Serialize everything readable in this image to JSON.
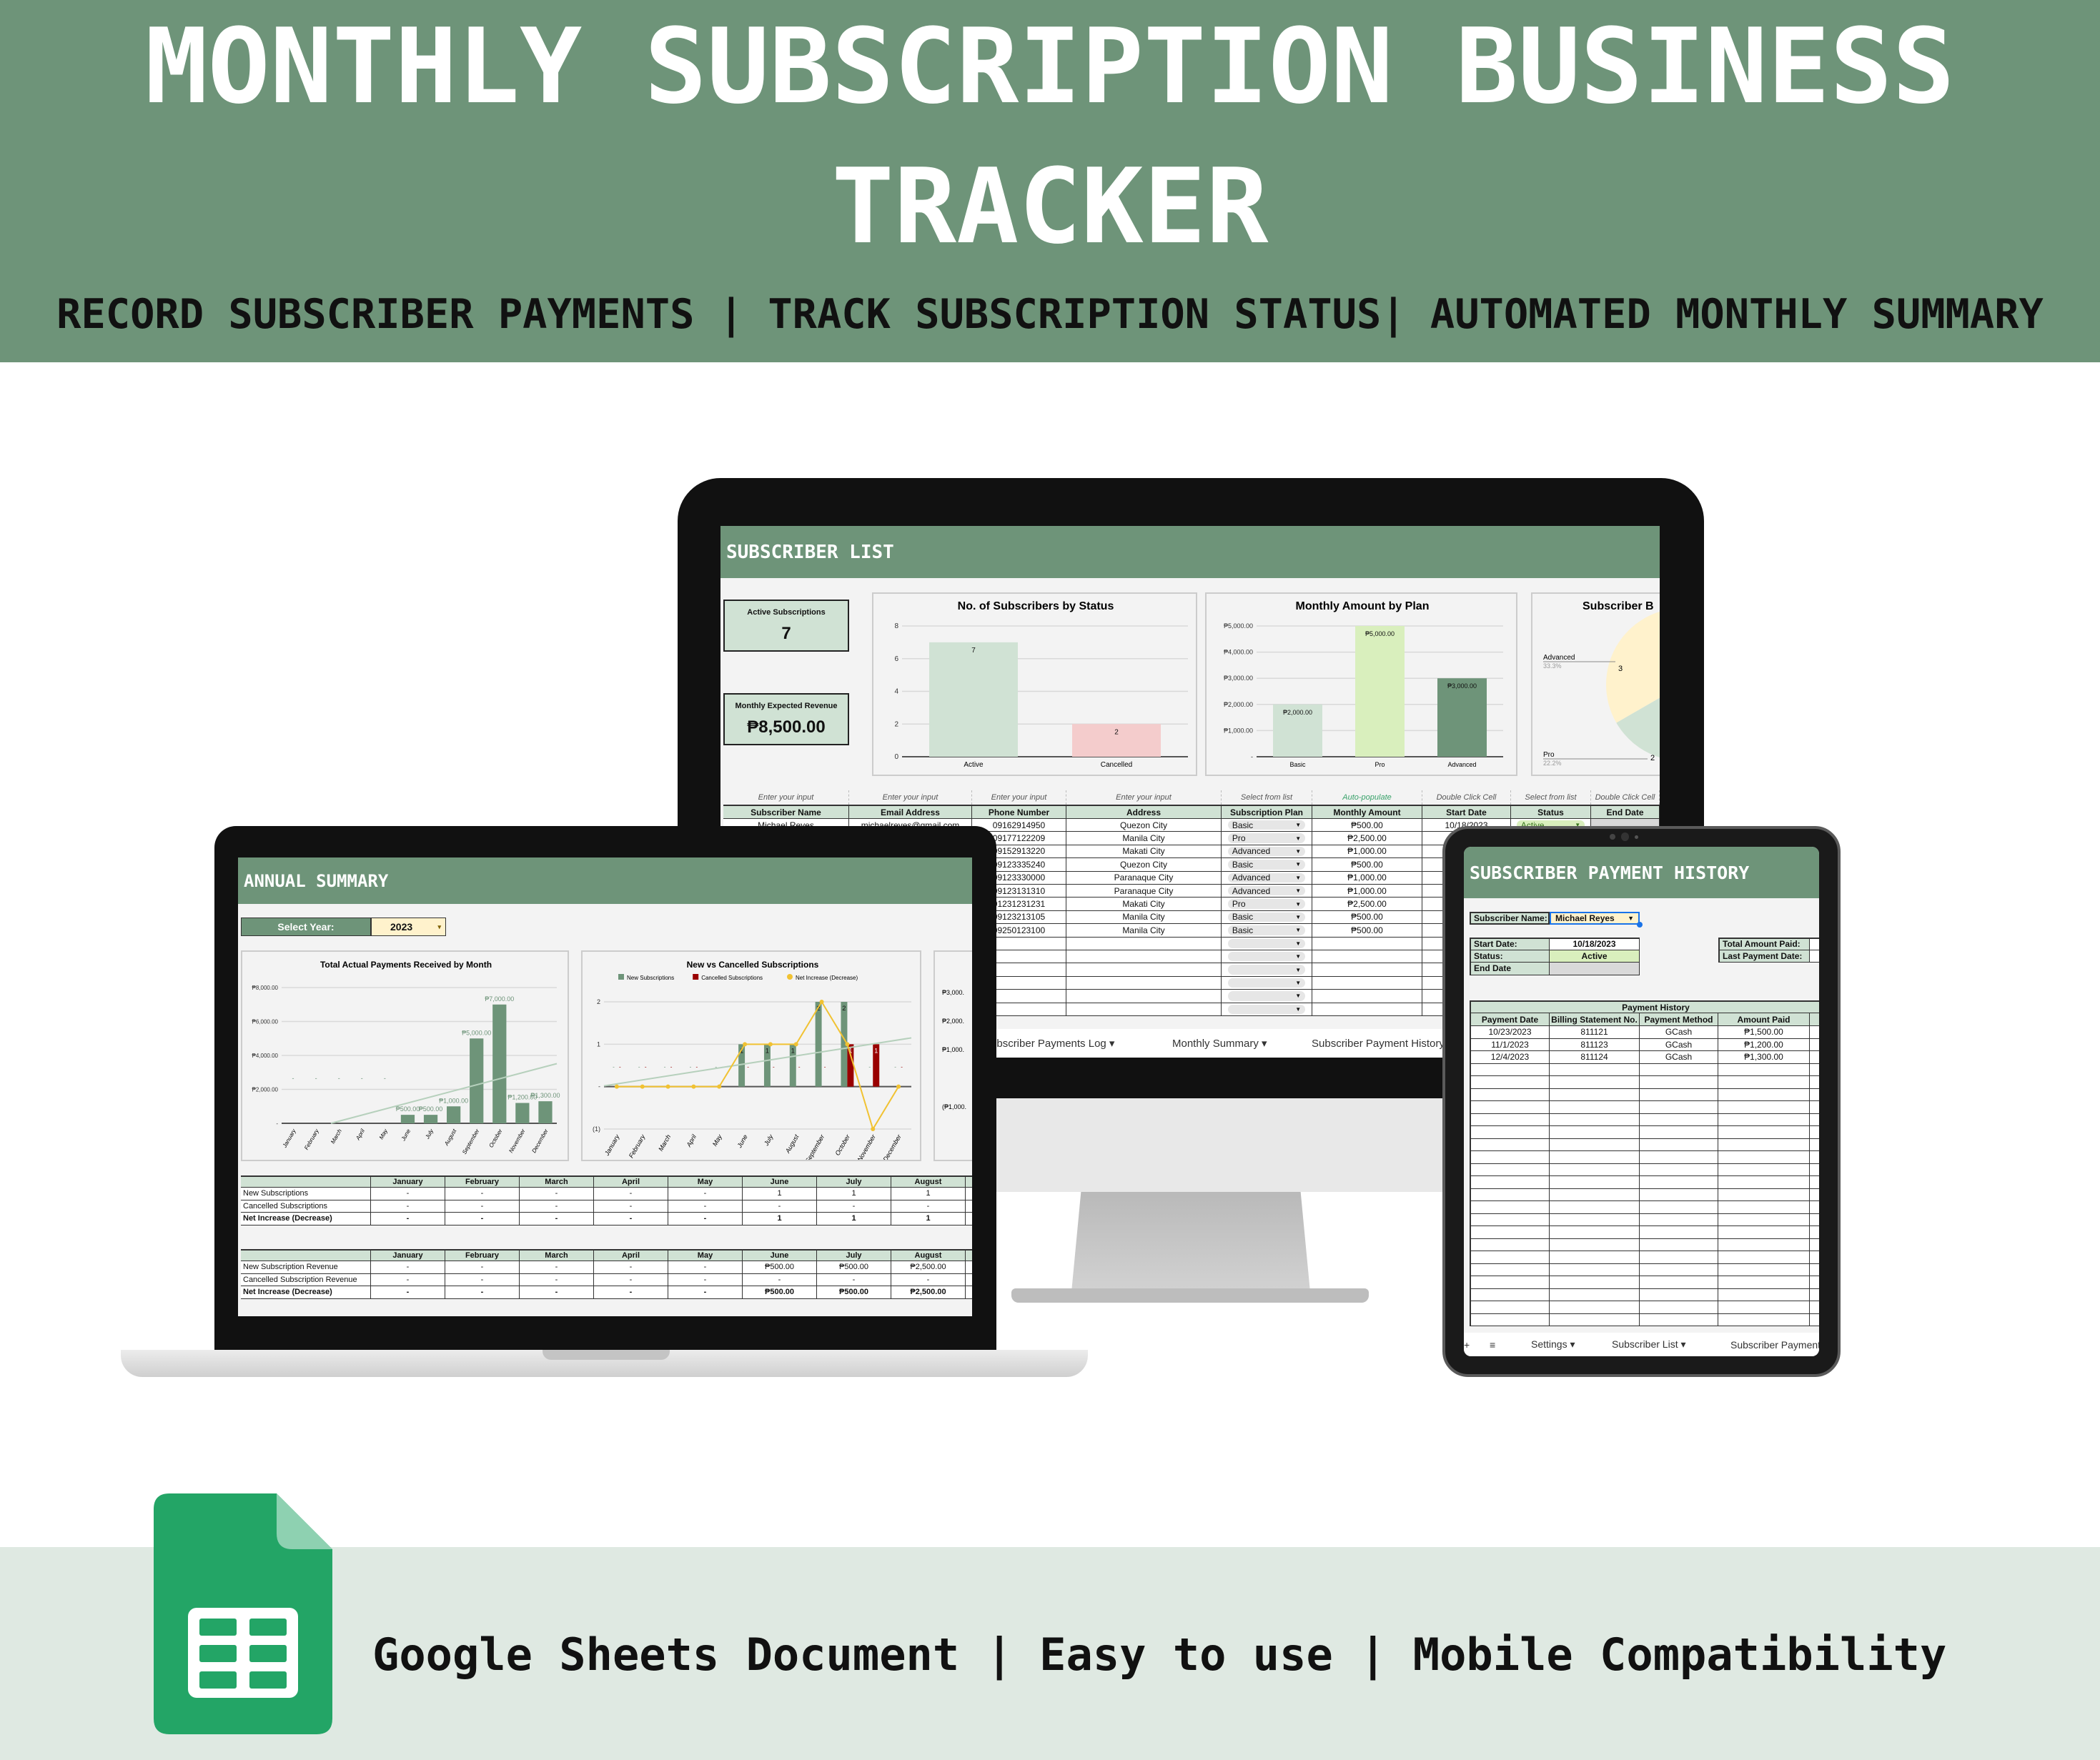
{
  "header": {
    "title": "MONTHLY SUBSCRIPTION BUSINESS TRACKER",
    "subtitle": "RECORD SUBSCRIBER PAYMENTS | TRACK SUBSCRIPTION STATUS| AUTOMATED MONTHLY SUMMARY"
  },
  "footer": {
    "text": "Google Sheets Document | Easy to use | Mobile Compatibility",
    "icon": "google-sheets-icon"
  },
  "colors": {
    "brand_green": "#6e9479",
    "light_green": "#d0e2d4",
    "footer_bg": "#dfe9e2",
    "yellow": "#fff2cc",
    "cancel_red": "#990000",
    "net_yellow": "#f1c232"
  },
  "monitor": {
    "sheet_title": "SUBSCRIBER LIST",
    "kpis": [
      {
        "label": "Active Subscriptions",
        "value": "7"
      },
      {
        "label": "Monthly Expected Revenue",
        "value": "₱8,500.00"
      }
    ],
    "table": {
      "hints": [
        "Enter your input",
        "Enter your input",
        "Enter your input",
        "Enter your input",
        "Select from list",
        "Auto-populate",
        "Double Click Cell",
        "Select from list",
        "Double Click Cell"
      ],
      "columns": [
        "Subscriber Name",
        "Email Address",
        "Phone Number",
        "Address",
        "Subscription Plan",
        "Monthly Amount",
        "Start Date",
        "Status",
        "End Date"
      ],
      "rows": [
        [
          "Michael Reyes",
          "michaelreyes@gmail.com",
          "09162914950",
          "Quezon City",
          "Basic",
          "₱500.00",
          "10/18/2023",
          "Active",
          ""
        ],
        [
          "",
          "",
          "09177122209",
          "Manila City",
          "Pro",
          "₱2,500.00",
          "",
          "",
          ""
        ],
        [
          "",
          "",
          "09152913220",
          "Makati City",
          "Advanced",
          "₱1,000.00",
          "",
          "",
          ""
        ],
        [
          "",
          "",
          "09123335240",
          "Quezon City",
          "Basic",
          "₱500.00",
          "",
          "",
          ""
        ],
        [
          "",
          "",
          "09123330000",
          "Paranaque City",
          "Advanced",
          "₱1,000.00",
          "",
          "",
          ""
        ],
        [
          "",
          "",
          "09123131310",
          "Paranaque City",
          "Advanced",
          "₱1,000.00",
          "",
          "",
          ""
        ],
        [
          "",
          "",
          "01231231231",
          "Makati City",
          "Pro",
          "₱2,500.00",
          "",
          "",
          ""
        ],
        [
          "",
          "",
          "09123213105",
          "Manila City",
          "Basic",
          "₱500.00",
          "",
          "",
          ""
        ],
        [
          "",
          "",
          "09250123100",
          "Manila City",
          "Basic",
          "₱500.00",
          "",
          "",
          ""
        ]
      ]
    },
    "tabs": [
      "Subscriber Payments Log",
      "Monthly Summary",
      "Subscriber Payment History"
    ]
  },
  "laptop": {
    "sheet_title": "ANNUAL SUMMARY",
    "select_year": {
      "label": "Select Year:",
      "value": "2023"
    },
    "table_counts": {
      "columns": [
        "",
        "January",
        "February",
        "March",
        "April",
        "May",
        "June",
        "July",
        "August"
      ],
      "rows": [
        [
          "New Subscriptions",
          "-",
          "-",
          "-",
          "-",
          "-",
          "1",
          "1",
          "1"
        ],
        [
          "Cancelled Subscriptions",
          "-",
          "-",
          "-",
          "-",
          "-",
          "-",
          "-",
          "-"
        ],
        [
          "Net Increase (Decrease)",
          "-",
          "-",
          "-",
          "-",
          "-",
          "1",
          "1",
          "1"
        ]
      ]
    },
    "table_revenue": {
      "columns": [
        "",
        "January",
        "February",
        "March",
        "April",
        "May",
        "June",
        "July",
        "August"
      ],
      "rows": [
        [
          "New Subscription Revenue",
          "-",
          "-",
          "-",
          "-",
          "-",
          "₱500.00",
          "₱500.00",
          "₱2,500.00"
        ],
        [
          "Cancelled Subscription Revenue",
          "-",
          "-",
          "-",
          "-",
          "-",
          "-",
          "-",
          "-"
        ],
        [
          "Net Increase (Decrease)",
          "-",
          "-",
          "-",
          "-",
          "-",
          "₱500.00",
          "₱500.00",
          "₱2,500.00"
        ]
      ]
    }
  },
  "tablet": {
    "sheet_title": "SUBSCRIBER PAYMENT HISTORY",
    "subscriber_name": {
      "label": "Subscriber Name:",
      "value": "Michael Reyes"
    },
    "details": [
      {
        "label": "Start Date:",
        "value": "10/18/2023"
      },
      {
        "label": "Status:",
        "value": "Active"
      },
      {
        "label": "End Date",
        "value": ""
      }
    ],
    "summary": [
      {
        "label": "Total Amount Paid:",
        "value": ""
      },
      {
        "label": "Last Payment Date:",
        "value": ""
      }
    ],
    "history": {
      "title": "Payment History",
      "columns": [
        "Payment Date",
        "Billing Statement No.",
        "Payment Method",
        "Amount Paid"
      ],
      "rows": [
        [
          "10/23/2023",
          "811121",
          "GCash",
          "₱1,500.00"
        ],
        [
          "11/1/2023",
          "811123",
          "GCash",
          "₱1,200.00"
        ],
        [
          "12/4/2023",
          "811124",
          "GCash",
          "₱1,300.00"
        ]
      ]
    },
    "tabs": [
      "Settings",
      "Subscriber List",
      "Subscriber Payment History"
    ]
  },
  "chart_data": [
    {
      "id": "status",
      "type": "bar",
      "title": "No. of Subscribers by Status",
      "categories": [
        "Active",
        "Cancelled"
      ],
      "values": [
        7,
        2
      ],
      "colors": [
        "#d0e2d4",
        "#f4cccc"
      ],
      "ylim": [
        0,
        8
      ],
      "yticks": [
        0,
        2,
        4,
        6,
        8
      ],
      "ytick_labels": [
        "0",
        "2",
        "4",
        "6",
        "8"
      ],
      "data_labels": [
        "7",
        "2"
      ],
      "grid": true
    },
    {
      "id": "plan",
      "type": "bar",
      "title": "Monthly Amount by Plan",
      "categories": [
        "Basic",
        "Pro",
        "Advanced"
      ],
      "values": [
        2000,
        5000,
        3000
      ],
      "colors": [
        "#d0e2d4",
        "#d9efbd",
        "#6e9479"
      ],
      "ylim": [
        0,
        5000
      ],
      "yticks": [
        0,
        1000,
        2000,
        3000,
        4000,
        5000
      ],
      "ytick_labels": [
        "-",
        "₱1,000.00",
        "₱2,000.00",
        "₱3,000.00",
        "₱4,000.00",
        "₱5,000.00"
      ],
      "data_labels": [
        "₱2,000.00",
        "₱5,000.00",
        "₱3,000.00"
      ],
      "grid": true
    },
    {
      "id": "breakdown",
      "type": "pie",
      "title": "Subscriber B",
      "slices": [
        {
          "label": "",
          "value": 4,
          "color": "#6e9479"
        },
        {
          "label": "Pro",
          "value": 2,
          "percent": "22.2%",
          "color": "#d0e2d4"
        },
        {
          "label": "Advanced",
          "value": 3,
          "percent": "33.3%",
          "color": "#fff2cc"
        }
      ]
    },
    {
      "id": "payments",
      "type": "bar",
      "title": "Total Actual Payments Received by Month",
      "categories": [
        "January",
        "February",
        "March",
        "April",
        "May",
        "June",
        "July",
        "August",
        "September",
        "October",
        "November",
        "December"
      ],
      "values": [
        0,
        0,
        0,
        0,
        0,
        500,
        500,
        1000,
        5000,
        7000,
        1200,
        1300
      ],
      "data_labels": [
        "-",
        "-",
        "-",
        "-",
        "-",
        "₱500.00",
        "₱500.00",
        "₱1,000.00",
        "₱5,000.00",
        "₱7,000.00",
        "₱1,200.00",
        "₱1,300.00"
      ],
      "colors": [
        "#6e9479"
      ],
      "ylim": [
        0,
        8000
      ],
      "yticks": [
        0,
        2000,
        4000,
        6000,
        8000
      ],
      "ytick_labels": [
        "-",
        "₱2,000.00",
        "₱4,000.00",
        "₱6,000.00",
        "₱8,000.00"
      ],
      "trendline": true,
      "grid": true
    },
    {
      "id": "new_vs_cancelled",
      "type": "bar",
      "title": "New vs Cancelled Subscriptions",
      "categories": [
        "January",
        "February",
        "March",
        "April",
        "May",
        "June",
        "July",
        "August",
        "September",
        "October",
        "November",
        "December"
      ],
      "series": [
        {
          "name": "New Subscriptions",
          "type": "bar",
          "color": "#6e9479",
          "values": [
            0,
            0,
            0,
            0,
            0,
            1,
            1,
            1,
            2,
            2,
            0,
            0
          ]
        },
        {
          "name": "Cancelled Subscriptions",
          "type": "bar",
          "color": "#990000",
          "values": [
            0,
            0,
            0,
            0,
            0,
            0,
            0,
            0,
            0,
            1,
            1,
            0
          ]
        },
        {
          "name": "Net Increase (Decrease)",
          "type": "line",
          "color": "#f1c232",
          "values": [
            0,
            0,
            0,
            0,
            0,
            1,
            1,
            1,
            2,
            1,
            -1,
            0
          ]
        }
      ],
      "ylim": [
        -1,
        2
      ],
      "yticks": [
        -1,
        0,
        1,
        2
      ],
      "ytick_labels": [
        "(1)",
        "-",
        "1",
        "2"
      ],
      "legend": "top",
      "trendline": true,
      "grid": true
    },
    {
      "id": "third_summary_chart",
      "type": "bar",
      "title": "",
      "ytick_labels": [
        "₱3,000.",
        "₱2,000.",
        "₱1,000.",
        "(₱1,000."
      ]
    }
  ]
}
